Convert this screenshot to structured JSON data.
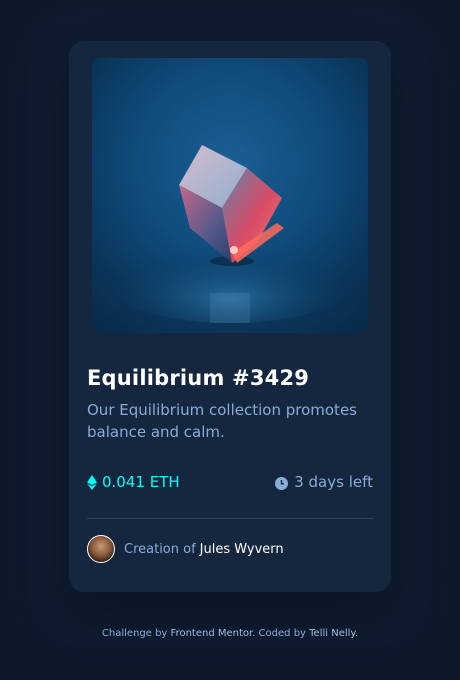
{
  "card": {
    "image_alt": "Equilibrium crystal cube",
    "title": "Equilibrium #3429",
    "description": "Our Equilibrium collection promotes balance and calm.",
    "price": "0.041 ETH",
    "time_left": "3 days left",
    "creator_prefix": "Creation of",
    "creator_name": "Jules Wyvern"
  },
  "footer": {
    "text1": "Challenge by",
    "link1": "Frontend Mentor",
    "text2": ". Coded by",
    "link2": "Telli Nelly",
    "text3": "."
  },
  "colors": {
    "background": "#0e1829",
    "card": "#15263f",
    "accent_cyan": "#00fff8",
    "soft_blue": "#8bacd9",
    "white": "#ffffff"
  },
  "icons": [
    "ethereum-icon",
    "clock-icon"
  ]
}
